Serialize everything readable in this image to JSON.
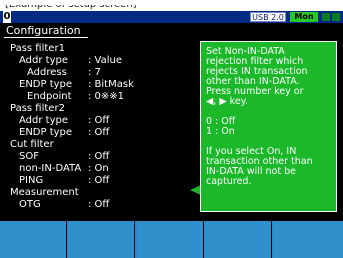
{
  "caption": "[Example of setup screen]",
  "statusbar": {
    "port": "0",
    "usb": "USB 2.0",
    "mode": "Mon"
  },
  "title": "Configuration",
  "settings": {
    "pass_filter1": {
      "header": "Pass filter1",
      "addr_type": {
        "label": "Addr type",
        "value": ": Value"
      },
      "address": {
        "label": "Address",
        "value": ":  7"
      },
      "endp_type": {
        "label": "ENDP type",
        "value": ": BitMask"
      },
      "endpoint": {
        "label": "Endpoint",
        "value": ": 0※※1"
      }
    },
    "pass_filter2": {
      "header": "Pass filter2",
      "addr_type": {
        "label": "Addr type",
        "value": ": Off"
      },
      "endp_type": {
        "label": "ENDP type",
        "value": ": Off"
      }
    },
    "cut_filter": {
      "header": "Cut filter",
      "sof": {
        "label": "SOF",
        "value": ": Off"
      },
      "non_in_data": {
        "label": "non-IN-DATA",
        "value": ": On"
      },
      "ping": {
        "label": "PING",
        "value": ": Off"
      }
    },
    "measurement": {
      "header": "Measurement",
      "otg": {
        "label": "OTG",
        "value": ": Off"
      }
    }
  },
  "help": {
    "text": "Set Non-IN-DATA\nrejection filter which\nrejects IN transaction\nother than IN-DATA.\nPress number key or\n◀, ▶ key.\n\n 0 : Off\n 1 : On\n\nIf you select On, IN\ntransaction other than\nIN-DATA will not be\ncaptured."
  },
  "softkeys": [
    "",
    "",
    "",
    "",
    ""
  ],
  "colors": {
    "screen_bg": "#000000",
    "topbar": "#002a84",
    "help_bg": "#1bb92a",
    "mon_badge": "#28c828",
    "softkey": "#2f90cc"
  }
}
